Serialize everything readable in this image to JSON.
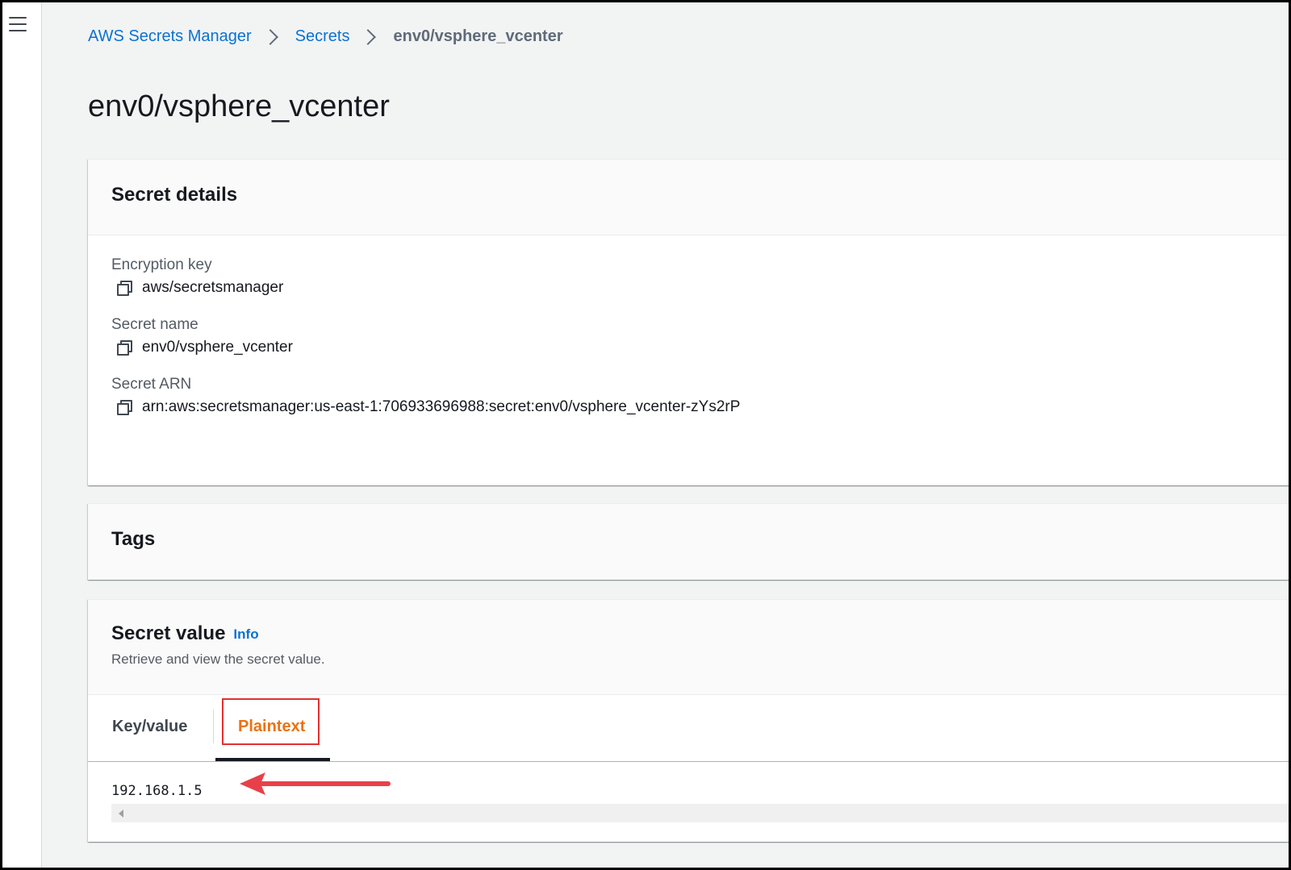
{
  "sidebar": {
    "menu_icon": "hamburger-menu-icon"
  },
  "breadcrumb": {
    "items": [
      "AWS Secrets Manager",
      "Secrets"
    ],
    "current": "env0/vsphere_vcenter",
    "separator_icon": "chevron-right-icon"
  },
  "page": {
    "title": "env0/vsphere_vcenter"
  },
  "secret_details": {
    "title": "Secret details",
    "fields": [
      {
        "label": "Encryption key",
        "value": "aws/secretsmanager",
        "icon": "copy-icon"
      },
      {
        "label": "Secret name",
        "value": "env0/vsphere_vcenter",
        "icon": "copy-icon"
      },
      {
        "label": "Secret ARN",
        "value": "arn:aws:secretsmanager:us-east-1:706933696988:secret:env0/vsphere_vcenter-zYs2rP",
        "icon": "copy-icon"
      }
    ]
  },
  "tags": {
    "title": "Tags"
  },
  "secret_value": {
    "title": "Secret value",
    "info_label": "Info",
    "description": "Retrieve and view the secret value.",
    "tabs": [
      {
        "label": "Key/value",
        "selected": false
      },
      {
        "label": "Plaintext",
        "selected": true
      }
    ],
    "plaintext_value": "192.168.1.5"
  },
  "annotations": {
    "highlight_color": "#e03131",
    "arrow_color": "#e8404a",
    "highlighted_element": "Plaintext tab"
  },
  "colors": {
    "link": "#0972d3",
    "active_tab": "#ec7211",
    "page_background": "#f2f3f3"
  }
}
